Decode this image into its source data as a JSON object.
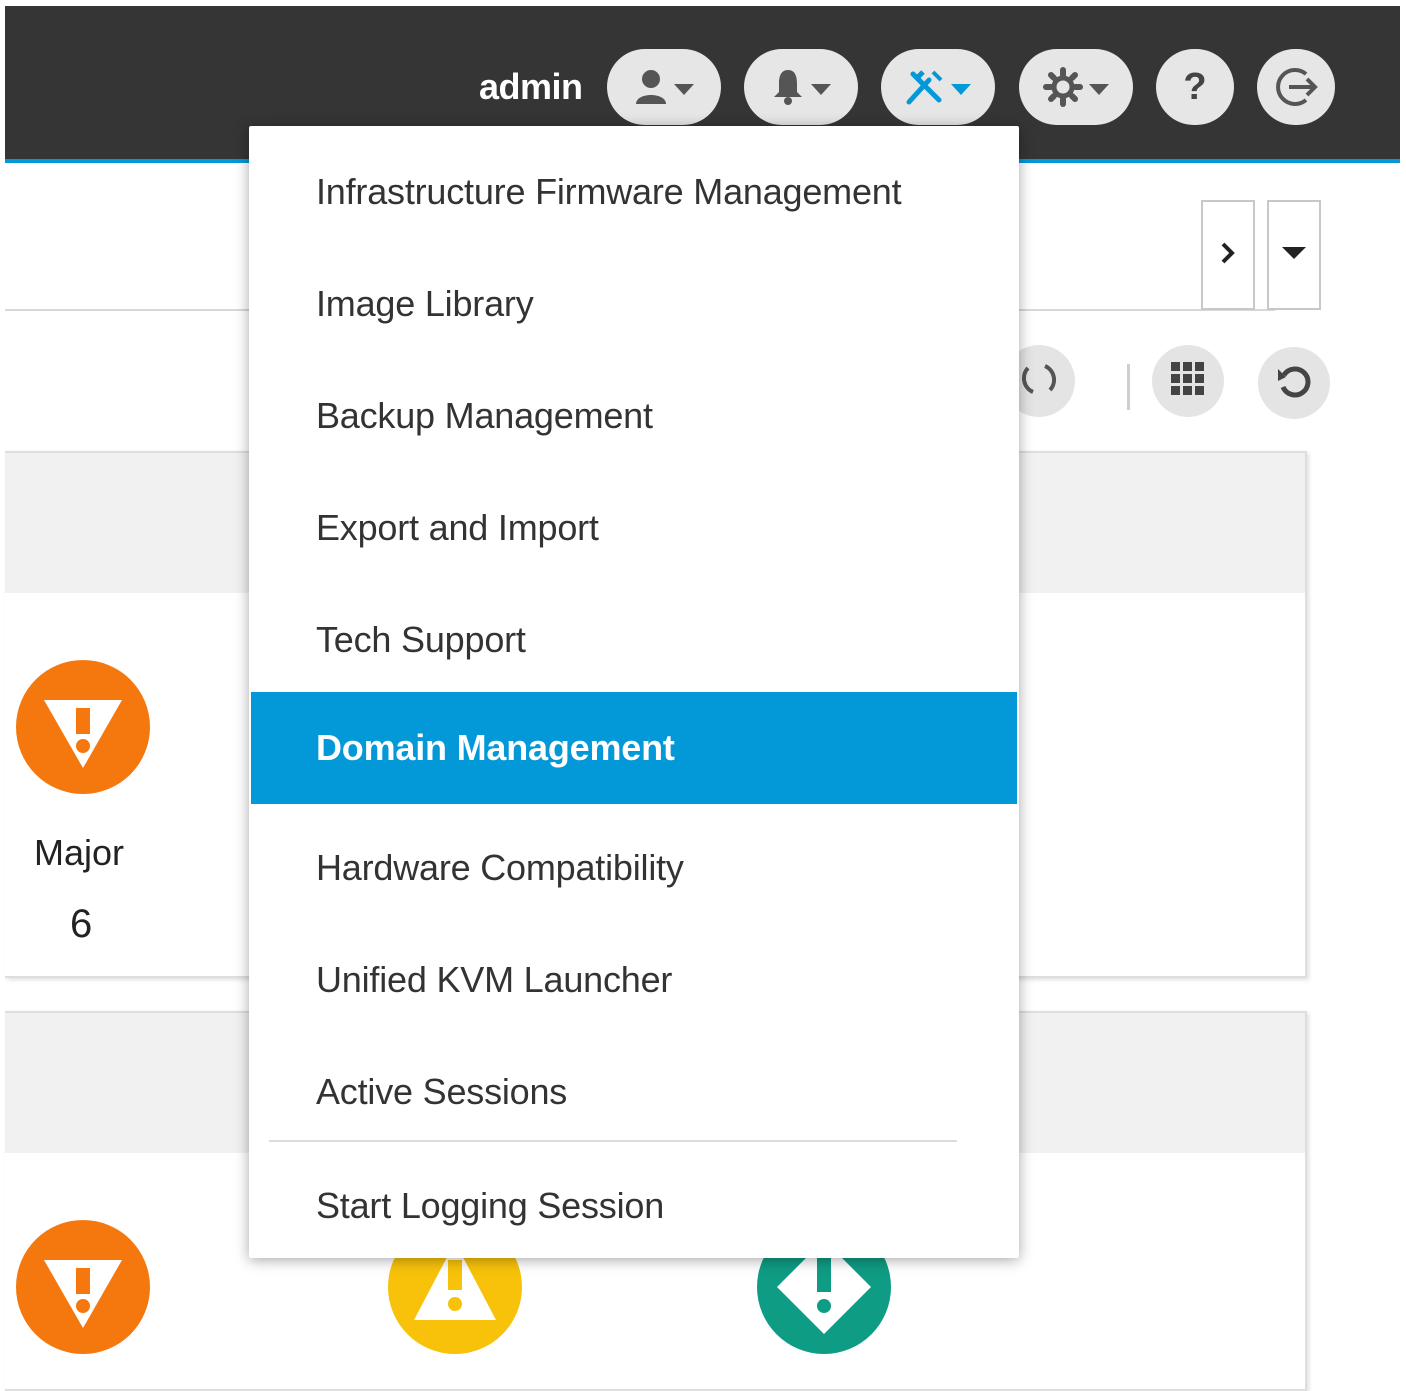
{
  "header": {
    "username": "admin",
    "buttons": [
      {
        "name": "user-menu-button",
        "icon": "user-icon"
      },
      {
        "name": "notifications-button",
        "icon": "bell-icon"
      },
      {
        "name": "tools-button",
        "icon": "wrench-screwdriver-icon",
        "active": true
      },
      {
        "name": "settings-button",
        "icon": "gear-icon"
      },
      {
        "name": "help-button",
        "icon": "question-icon"
      },
      {
        "name": "logout-button",
        "icon": "logout-icon"
      }
    ],
    "help_glyph": "?"
  },
  "colors": {
    "topbar": "#353535",
    "accent": "#0398d8",
    "major": "#f5780f",
    "minor": "#f8c20a",
    "warning": "#0f9c84"
  },
  "tools_menu": {
    "items": [
      "Infrastructure Firmware Management",
      "Image Library",
      "Backup Management",
      "Export and Import",
      "Tech Support",
      "Domain Management",
      "Hardware Compatibility",
      "Unified KVM Launcher",
      "Active Sessions",
      "Start Logging Session"
    ],
    "selected": "Domain Management"
  },
  "alarms": {
    "major_label": "Major",
    "major_count": "6"
  }
}
